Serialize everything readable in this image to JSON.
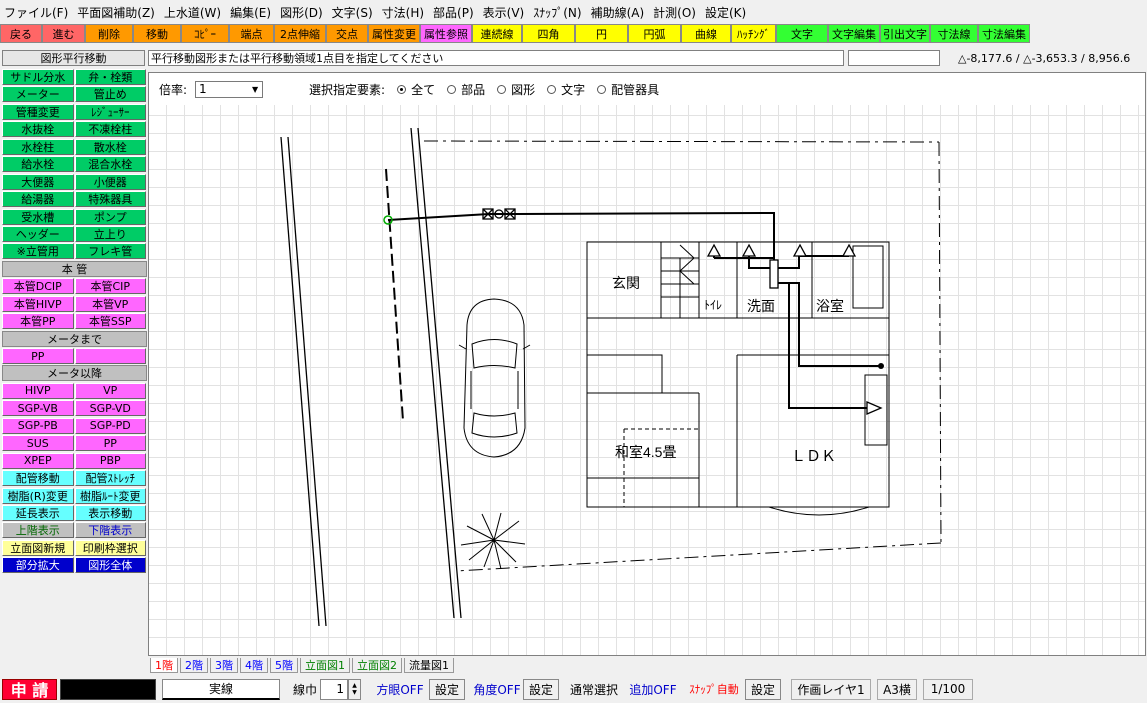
{
  "menubar": [
    "ファイル(F)",
    "平面図補助(Z)",
    "上水道(W)",
    "編集(E)",
    "図形(D)",
    "文字(S)",
    "寸法(H)",
    "部品(P)",
    "表示(V)",
    "ｽﾅｯﾌﾟ(N)",
    "補助線(A)",
    "計測(O)",
    "設定(K)"
  ],
  "toolbar": [
    {
      "label": "戻る",
      "bg": "#ff6666"
    },
    {
      "label": "進む",
      "bg": "#ff6666"
    },
    {
      "label": "削除",
      "bg": "#ff9900"
    },
    {
      "label": "移動",
      "bg": "#ff9900"
    },
    {
      "label": "ｺﾋﾟｰ",
      "bg": "#ff9900"
    },
    {
      "label": "端点",
      "bg": "#ff9900"
    },
    {
      "label": "2点伸縮",
      "bg": "#ff9900"
    },
    {
      "label": "交点",
      "bg": "#ff9900"
    },
    {
      "label": "属性変更",
      "bg": "#ff9900"
    },
    {
      "label": "属性参照",
      "bg": "#ff66ff"
    },
    {
      "label": "連続線",
      "bg": "#ffff00"
    },
    {
      "label": "四角",
      "bg": "#ffff00"
    },
    {
      "label": "円",
      "bg": "#ffff00"
    },
    {
      "label": "円弧",
      "bg": "#ffff00"
    },
    {
      "label": "曲線",
      "bg": "#ffff00"
    },
    {
      "label": "ﾊｯﾁﾝｸﾞ",
      "bg": "#ffff00"
    },
    {
      "label": "文字",
      "bg": "#33ff33"
    },
    {
      "label": "文字編集",
      "bg": "#33ff33"
    },
    {
      "label": "引出文字",
      "bg": "#33ff33"
    },
    {
      "label": "寸法線",
      "bg": "#33ff33"
    },
    {
      "label": "寸法編集",
      "bg": "#33ff33"
    }
  ],
  "status": {
    "panel_title": "図形平行移動",
    "prompt": "平行移動図形または平行移動領域1点目を指定してください",
    "coords": "△-8,177.6 / △-3,653.3 / 8,956.6"
  },
  "palette": [
    {
      "type": "pair",
      "items": [
        {
          "label": "サドル分水",
          "bg": "#00cc66",
          "fg": "#000"
        },
        {
          "label": "弁・栓類",
          "bg": "#00cc66",
          "fg": "#000"
        }
      ]
    },
    {
      "type": "pair",
      "items": [
        {
          "label": "メーター",
          "bg": "#00cc66",
          "fg": "#000"
        },
        {
          "label": "管止め",
          "bg": "#00cc66",
          "fg": "#000"
        }
      ]
    },
    {
      "type": "pair",
      "items": [
        {
          "label": "管種変更",
          "bg": "#00cc66",
          "fg": "#000"
        },
        {
          "label": "ﾚｼﾞｭｰｻｰ",
          "bg": "#00cc66",
          "fg": "#000"
        }
      ]
    },
    {
      "type": "pair",
      "items": [
        {
          "label": "水抜栓",
          "bg": "#00cc66",
          "fg": "#000"
        },
        {
          "label": "不凍栓柱",
          "bg": "#00cc66",
          "fg": "#000"
        }
      ]
    },
    {
      "type": "pair",
      "items": [
        {
          "label": "水栓柱",
          "bg": "#00cc66",
          "fg": "#000"
        },
        {
          "label": "散水栓",
          "bg": "#00cc66",
          "fg": "#000"
        }
      ]
    },
    {
      "type": "pair",
      "items": [
        {
          "label": "給水栓",
          "bg": "#00cc66",
          "fg": "#000"
        },
        {
          "label": "混合水栓",
          "bg": "#00cc66",
          "fg": "#000"
        }
      ]
    },
    {
      "type": "pair",
      "items": [
        {
          "label": "大便器",
          "bg": "#00cc66",
          "fg": "#000"
        },
        {
          "label": "小便器",
          "bg": "#00cc66",
          "fg": "#000"
        }
      ]
    },
    {
      "type": "pair",
      "items": [
        {
          "label": "給湯器",
          "bg": "#00cc66",
          "fg": "#000"
        },
        {
          "label": "特殊器具",
          "bg": "#00cc66",
          "fg": "#000"
        }
      ]
    },
    {
      "type": "pair",
      "items": [
        {
          "label": "受水槽",
          "bg": "#00cc66",
          "fg": "#000"
        },
        {
          "label": "ポンプ",
          "bg": "#00cc66",
          "fg": "#000"
        }
      ]
    },
    {
      "type": "pair",
      "items": [
        {
          "label": "ヘッダー",
          "bg": "#00cc66",
          "fg": "#000"
        },
        {
          "label": "立上り",
          "bg": "#00cc66",
          "fg": "#000"
        }
      ]
    },
    {
      "type": "pair",
      "items": [
        {
          "label": "※立管用",
          "bg": "#00cc66",
          "fg": "#000"
        },
        {
          "label": "フレキ管",
          "bg": "#00cc66",
          "fg": "#000"
        }
      ]
    },
    {
      "type": "header",
      "label": "本 管"
    },
    {
      "type": "pair",
      "items": [
        {
          "label": "本管DCIP",
          "bg": "#ff66ff",
          "fg": "#000"
        },
        {
          "label": "本管CIP",
          "bg": "#ff66ff",
          "fg": "#000"
        }
      ]
    },
    {
      "type": "pair",
      "items": [
        {
          "label": "本管HIVP",
          "bg": "#ff66ff",
          "fg": "#000"
        },
        {
          "label": "本管VP",
          "bg": "#ff66ff",
          "fg": "#000"
        }
      ]
    },
    {
      "type": "pair",
      "items": [
        {
          "label": "本管PP",
          "bg": "#ff66ff",
          "fg": "#000"
        },
        {
          "label": "本管SSP",
          "bg": "#ff66ff",
          "fg": "#000"
        }
      ]
    },
    {
      "type": "header",
      "label": "メータまで"
    },
    {
      "type": "pair",
      "items": [
        {
          "label": "PP",
          "bg": "#ff66ff",
          "fg": "#000"
        },
        {
          "label": "",
          "bg": "#ff66ff",
          "fg": "#000"
        }
      ]
    },
    {
      "type": "header",
      "label": "メータ以降"
    },
    {
      "type": "pair",
      "items": [
        {
          "label": "HIVP",
          "bg": "#ff66ff",
          "fg": "#000"
        },
        {
          "label": "VP",
          "bg": "#ff66ff",
          "fg": "#000"
        }
      ]
    },
    {
      "type": "pair",
      "items": [
        {
          "label": "SGP-VB",
          "bg": "#ff66ff",
          "fg": "#000"
        },
        {
          "label": "SGP-VD",
          "bg": "#ff66ff",
          "fg": "#000"
        }
      ]
    },
    {
      "type": "pair",
      "items": [
        {
          "label": "SGP-PB",
          "bg": "#ff66ff",
          "fg": "#000"
        },
        {
          "label": "SGP-PD",
          "bg": "#ff66ff",
          "fg": "#000"
        }
      ]
    },
    {
      "type": "pair",
      "items": [
        {
          "label": "SUS",
          "bg": "#ff66ff",
          "fg": "#000"
        },
        {
          "label": "PP",
          "bg": "#ff66ff",
          "fg": "#000"
        }
      ]
    },
    {
      "type": "pair",
      "items": [
        {
          "label": "XPEP",
          "bg": "#ff66ff",
          "fg": "#000"
        },
        {
          "label": "PBP",
          "bg": "#ff66ff",
          "fg": "#000"
        }
      ]
    },
    {
      "type": "pair",
      "items": [
        {
          "label": "配管移動",
          "bg": "#66ffff",
          "fg": "#000"
        },
        {
          "label": "配管ｽﾄﾚｯﾁ",
          "bg": "#66ffff",
          "fg": "#000"
        }
      ]
    },
    {
      "type": "pair",
      "items": [
        {
          "label": "樹脂(R)変更",
          "bg": "#66ffff",
          "fg": "#000"
        },
        {
          "label": "樹脂ﾙｰﾄ変更",
          "bg": "#66ffff",
          "fg": "#000"
        }
      ]
    },
    {
      "type": "pair",
      "items": [
        {
          "label": "延長表示",
          "bg": "#66ffff",
          "fg": "#000"
        },
        {
          "label": "表示移動",
          "bg": "#66ffff",
          "fg": "#000"
        }
      ]
    },
    {
      "type": "pair",
      "items": [
        {
          "label": "上階表示",
          "bg": "#c0c0c0",
          "fg": "#006600"
        },
        {
          "label": "下階表示",
          "bg": "#c0c0c0",
          "fg": "#0000cc"
        }
      ]
    },
    {
      "type": "pair",
      "items": [
        {
          "label": "立面図新規",
          "bg": "#ffff99",
          "fg": "#000"
        },
        {
          "label": "印刷枠選択",
          "bg": "#ffff99",
          "fg": "#000"
        }
      ]
    },
    {
      "type": "pair",
      "items": [
        {
          "label": "部分拡大",
          "bg": "#0000cc",
          "fg": "#fff"
        },
        {
          "label": "図形全体",
          "bg": "#0000cc",
          "fg": "#fff"
        }
      ]
    }
  ],
  "zoom": {
    "label": "倍率:",
    "value": "1"
  },
  "selection": {
    "label": "選択指定要素:",
    "options": [
      {
        "label": "全て",
        "checked": true
      },
      {
        "label": "部品",
        "checked": false
      },
      {
        "label": "図形",
        "checked": false
      },
      {
        "label": "文字",
        "checked": false
      },
      {
        "label": "配管器具",
        "checked": false
      }
    ]
  },
  "drawing": {
    "rooms": [
      "玄関",
      "ﾄｲﾚ",
      "洗面",
      "浴室",
      "和室4.5畳",
      "ＬＤＫ"
    ]
  },
  "floor_tabs": [
    {
      "label": "1階",
      "color": "#ff0000"
    },
    {
      "label": "2階",
      "color": "#0000ff"
    },
    {
      "label": "3階",
      "color": "#0000ff"
    },
    {
      "label": "4階",
      "color": "#0000ff"
    },
    {
      "label": "5階",
      "color": "#0000ff"
    },
    {
      "label": "立面図1",
      "color": "#008000"
    },
    {
      "label": "立面図2",
      "color": "#008000"
    },
    {
      "label": "流量図1",
      "color": "#000000"
    }
  ],
  "statusbar": {
    "shinsei": "申 請",
    "line_type": "実線",
    "line_width_label": "線巾",
    "line_width_value": "1",
    "grid": "方眼OFF",
    "settings1": "設定",
    "angle": "角度OFF",
    "settings2": "設定",
    "select_mode": "通常選択",
    "add_mode": "追加OFF",
    "snap": "ｽﾅｯﾌﾟ自動",
    "settings3": "設定",
    "layer": "作画レイヤ1",
    "paper": "A3横",
    "scale": "1/100"
  }
}
